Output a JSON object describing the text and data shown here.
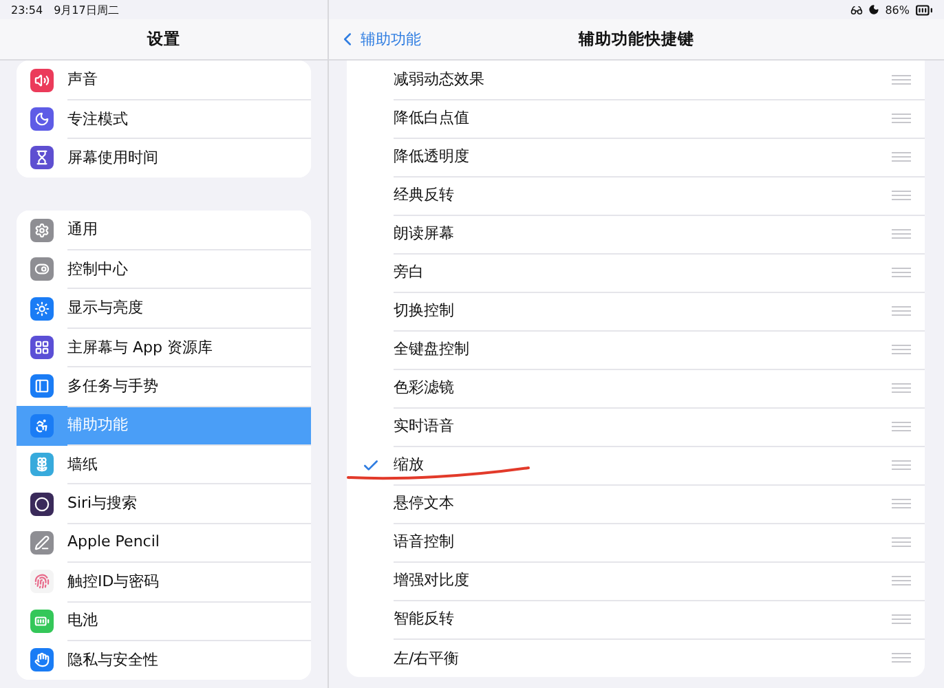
{
  "status_bar": {
    "time": "23:54",
    "date": "9月17日周二",
    "battery": "86%"
  },
  "sidebar": {
    "title": "设置",
    "groups": [
      {
        "items": [
          {
            "label": "声音",
            "color": "#eb3b5a",
            "selected": false
          },
          {
            "label": "专注模式",
            "color": "#5e5ce6",
            "selected": false
          },
          {
            "label": "屏幕使用时间",
            "color": "#5e4fd1",
            "selected": false
          }
        ]
      },
      {
        "items": [
          {
            "label": "通用",
            "color": "#8e8e93",
            "selected": false
          },
          {
            "label": "控制中心",
            "color": "#8e8e93",
            "selected": false
          },
          {
            "label": "显示与亮度",
            "color": "#1a7cf5",
            "selected": false
          },
          {
            "label": "主屏幕与 App 资源库",
            "color": "#5b4fd6",
            "selected": false
          },
          {
            "label": "多任务与手势",
            "color": "#1a7cf5",
            "selected": false
          },
          {
            "label": "辅助功能",
            "color": "#1a7cf5",
            "selected": true
          },
          {
            "label": "墙纸",
            "color": "#37aadc",
            "selected": false
          },
          {
            "label": "Siri与搜索",
            "color": "#3a2a5a",
            "selected": false
          },
          {
            "label": "Apple Pencil",
            "color": "#8e8e93",
            "selected": false
          },
          {
            "label": "触控ID与密码",
            "color": "#f4f4f4",
            "selected": false
          },
          {
            "label": "电池",
            "color": "#34c759",
            "selected": false
          },
          {
            "label": "隐私与安全性",
            "color": "#1a7cf5",
            "selected": false
          }
        ]
      }
    ]
  },
  "detail": {
    "back": "辅助功能",
    "title": "辅助功能快捷键",
    "items": [
      {
        "label": "减弱动态效果",
        "checked": false
      },
      {
        "label": "降低白点值",
        "checked": false
      },
      {
        "label": "降低透明度",
        "checked": false
      },
      {
        "label": "经典反转",
        "checked": false
      },
      {
        "label": "朗读屏幕",
        "checked": false
      },
      {
        "label": "旁白",
        "checked": false
      },
      {
        "label": "切换控制",
        "checked": false
      },
      {
        "label": "全键盘控制",
        "checked": false
      },
      {
        "label": "色彩滤镜",
        "checked": false
      },
      {
        "label": "实时语音",
        "checked": false
      },
      {
        "label": "缩放",
        "checked": true
      },
      {
        "label": "悬停文本",
        "checked": false
      },
      {
        "label": "语音控制",
        "checked": false
      },
      {
        "label": "增强对比度",
        "checked": false
      },
      {
        "label": "智能反转",
        "checked": false
      },
      {
        "label": "左/右平衡",
        "checked": false
      }
    ]
  }
}
